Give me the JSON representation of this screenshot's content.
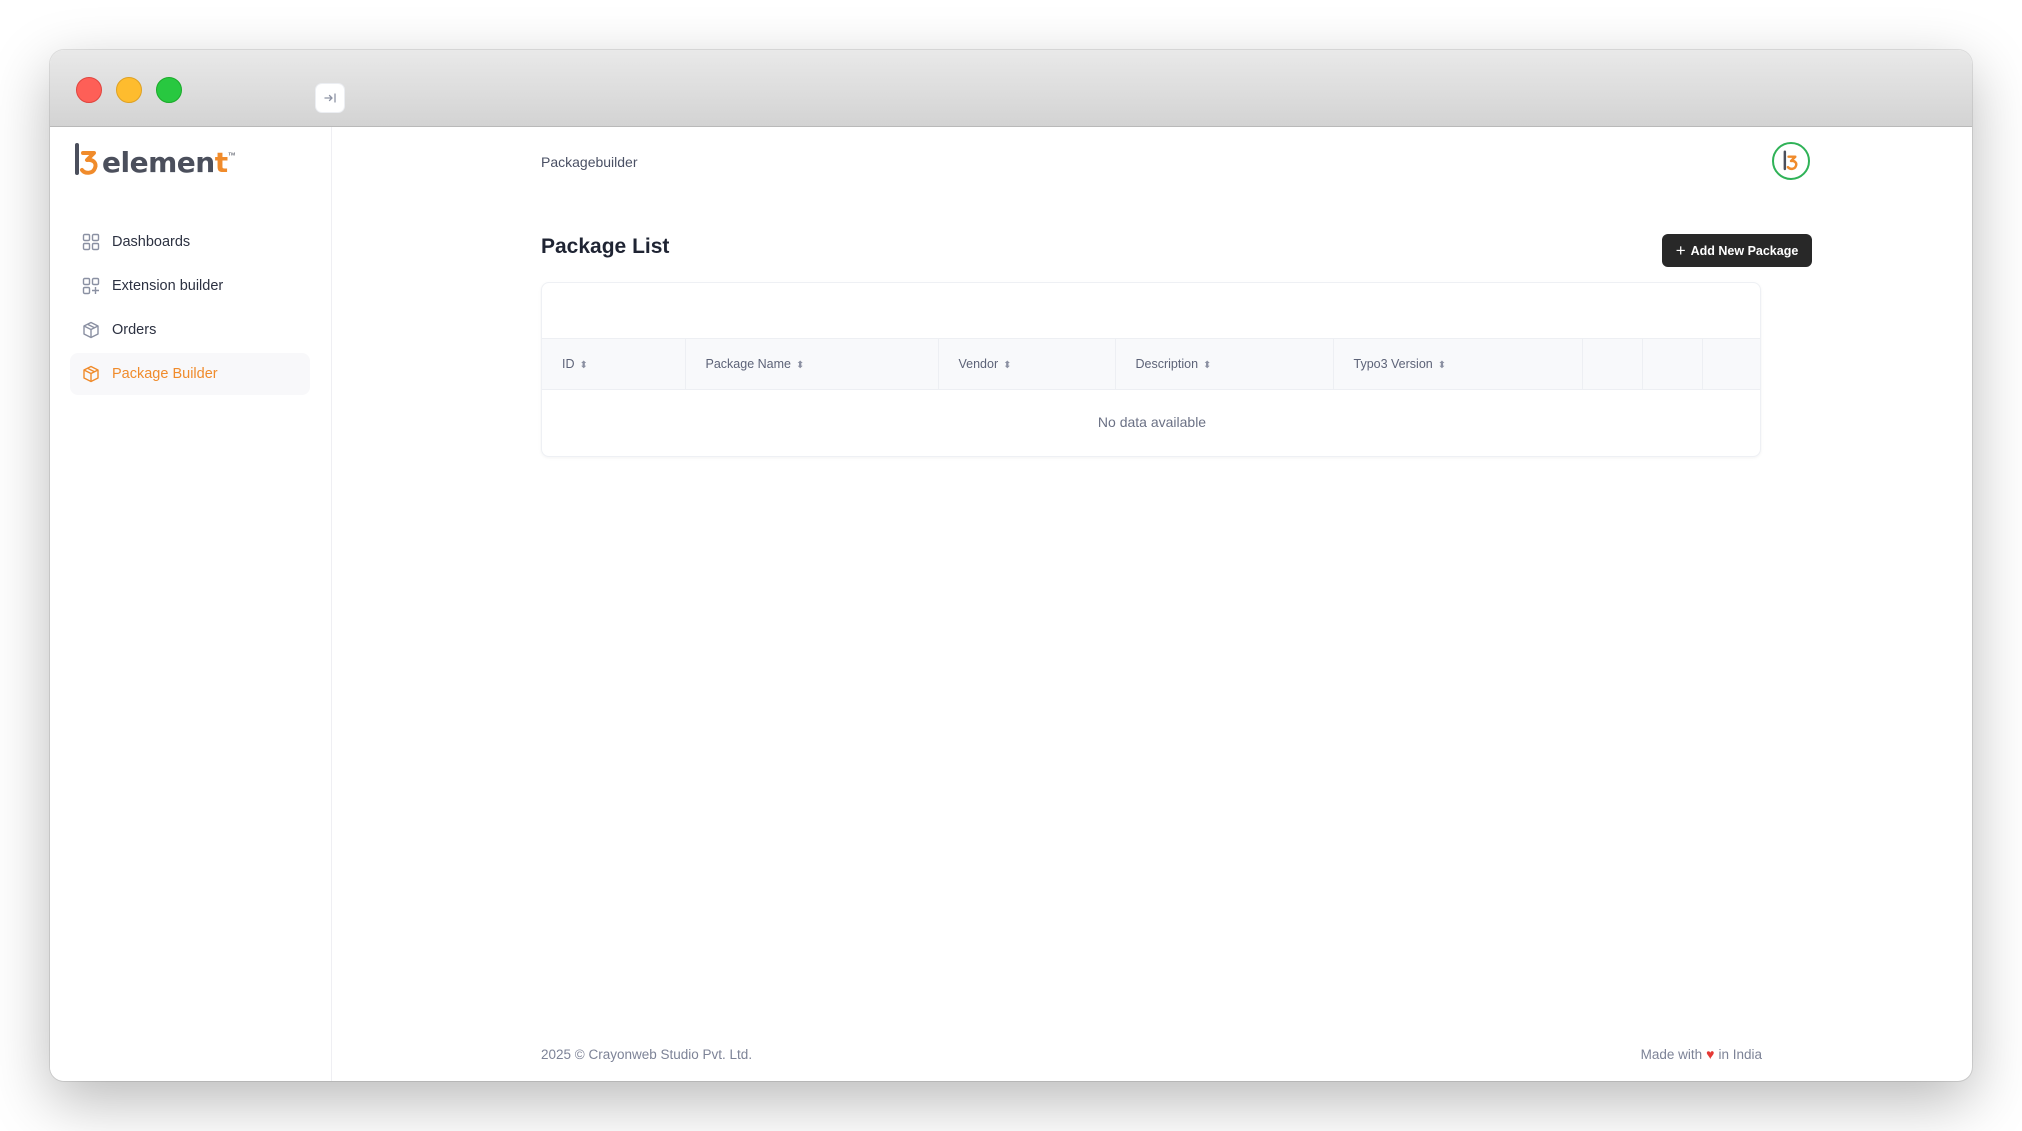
{
  "brand": {
    "name_prefix": "elemen",
    "name_suffix": "t",
    "trademark": "™",
    "accent": "#f08b2b"
  },
  "sidebar": {
    "collapse_icon": "collapse-right-icon",
    "items": [
      {
        "label": "Dashboards",
        "icon": "grid-icon",
        "active": false
      },
      {
        "label": "Extension builder",
        "icon": "grid-plus-icon",
        "active": false
      },
      {
        "label": "Orders",
        "icon": "cube-icon",
        "active": false
      },
      {
        "label": "Package Builder",
        "icon": "package-icon",
        "active": true
      }
    ]
  },
  "header": {
    "breadcrumb": "Packagebuilder"
  },
  "page": {
    "title": "Package List",
    "add_button_label": "Add New Package"
  },
  "table": {
    "columns": [
      "ID",
      "Package Name",
      "Vendor",
      "Description",
      "Typo3 Version",
      "",
      "",
      ""
    ],
    "rows": [],
    "empty_message": "No data available"
  },
  "footer": {
    "copyright": "2025 ©  Crayonweb Studio Pvt. Ltd.",
    "made_with_prefix": "Made with",
    "made_with_suffix": "in India"
  },
  "colors": {
    "active": "#f08b2b",
    "button_bg": "#282828",
    "avatar_ring": "#2fb257",
    "heart": "#e53935"
  }
}
